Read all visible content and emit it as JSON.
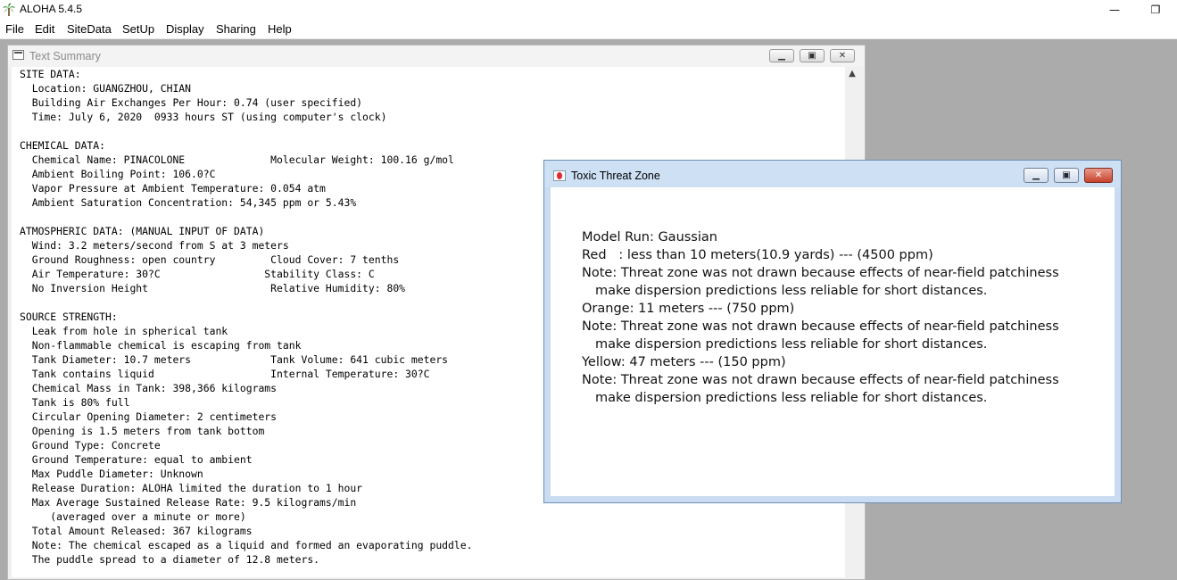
{
  "app": {
    "title": "ALOHA 5.4.5",
    "minimize_glyph": "—",
    "restore_glyph": "❐"
  },
  "menu": [
    "File",
    "Edit",
    "SiteData",
    "SetUp",
    "Display",
    "Sharing",
    "Help"
  ],
  "text_summary": {
    "title": "Text Summary",
    "lines": [
      "SITE DATA:",
      "  Location: GUANGZHOU, CHIAN",
      "  Building Air Exchanges Per Hour: 0.74 (user specified)",
      "  Time: July 6, 2020  0933 hours ST (using computer's clock)",
      "",
      "CHEMICAL DATA:",
      "  Chemical Name: PINACOLONE              Molecular Weight: 100.16 g/mol",
      "  Ambient Boiling Point: 106.0?C",
      "  Vapor Pressure at Ambient Temperature: 0.054 atm",
      "  Ambient Saturation Concentration: 54,345 ppm or 5.43%",
      "",
      "ATMOSPHERIC DATA: (MANUAL INPUT OF DATA)",
      "  Wind: 3.2 meters/second from S at 3 meters",
      "  Ground Roughness: open country         Cloud Cover: 7 tenths",
      "  Air Temperature: 30?C                 Stability Class: C",
      "  No Inversion Height                    Relative Humidity: 80%",
      "",
      "SOURCE STRENGTH:",
      "  Leak from hole in spherical tank",
      "  Non-flammable chemical is escaping from tank",
      "  Tank Diameter: 10.7 meters             Tank Volume: 641 cubic meters",
      "  Tank contains liquid                   Internal Temperature: 30?C",
      "  Chemical Mass in Tank: 398,366 kilograms",
      "  Tank is 80% full",
      "  Circular Opening Diameter: 2 centimeters",
      "  Opening is 1.5 meters from tank bottom",
      "  Ground Type: Concrete",
      "  Ground Temperature: equal to ambient",
      "  Max Puddle Diameter: Unknown",
      "  Release Duration: ALOHA limited the duration to 1 hour",
      "  Max Average Sustained Release Rate: 9.5 kilograms/min",
      "     (averaged over a minute or more)",
      "  Total Amount Released: 367 kilograms",
      "  Note: The chemical escaped as a liquid and formed an evaporating puddle.",
      "  The puddle spread to a diameter of 12.8 meters."
    ]
  },
  "threat_zone": {
    "title": "Toxic Threat Zone",
    "model_run": "Model Run: Gaussian",
    "red": "Red   : less than 10 meters(10.9 yards) --- (4500 ppm)",
    "orange": "Orange: 11 meters --- (750 ppm)",
    "yellow": "Yellow: 47 meters --- (150 ppm)",
    "note_line1": "Note: Threat zone was not drawn because effects of near-field patchiness",
    "note_line2": "make dispersion predictions less reliable for short distances.",
    "colors": {
      "red": "#e4282e"
    }
  }
}
